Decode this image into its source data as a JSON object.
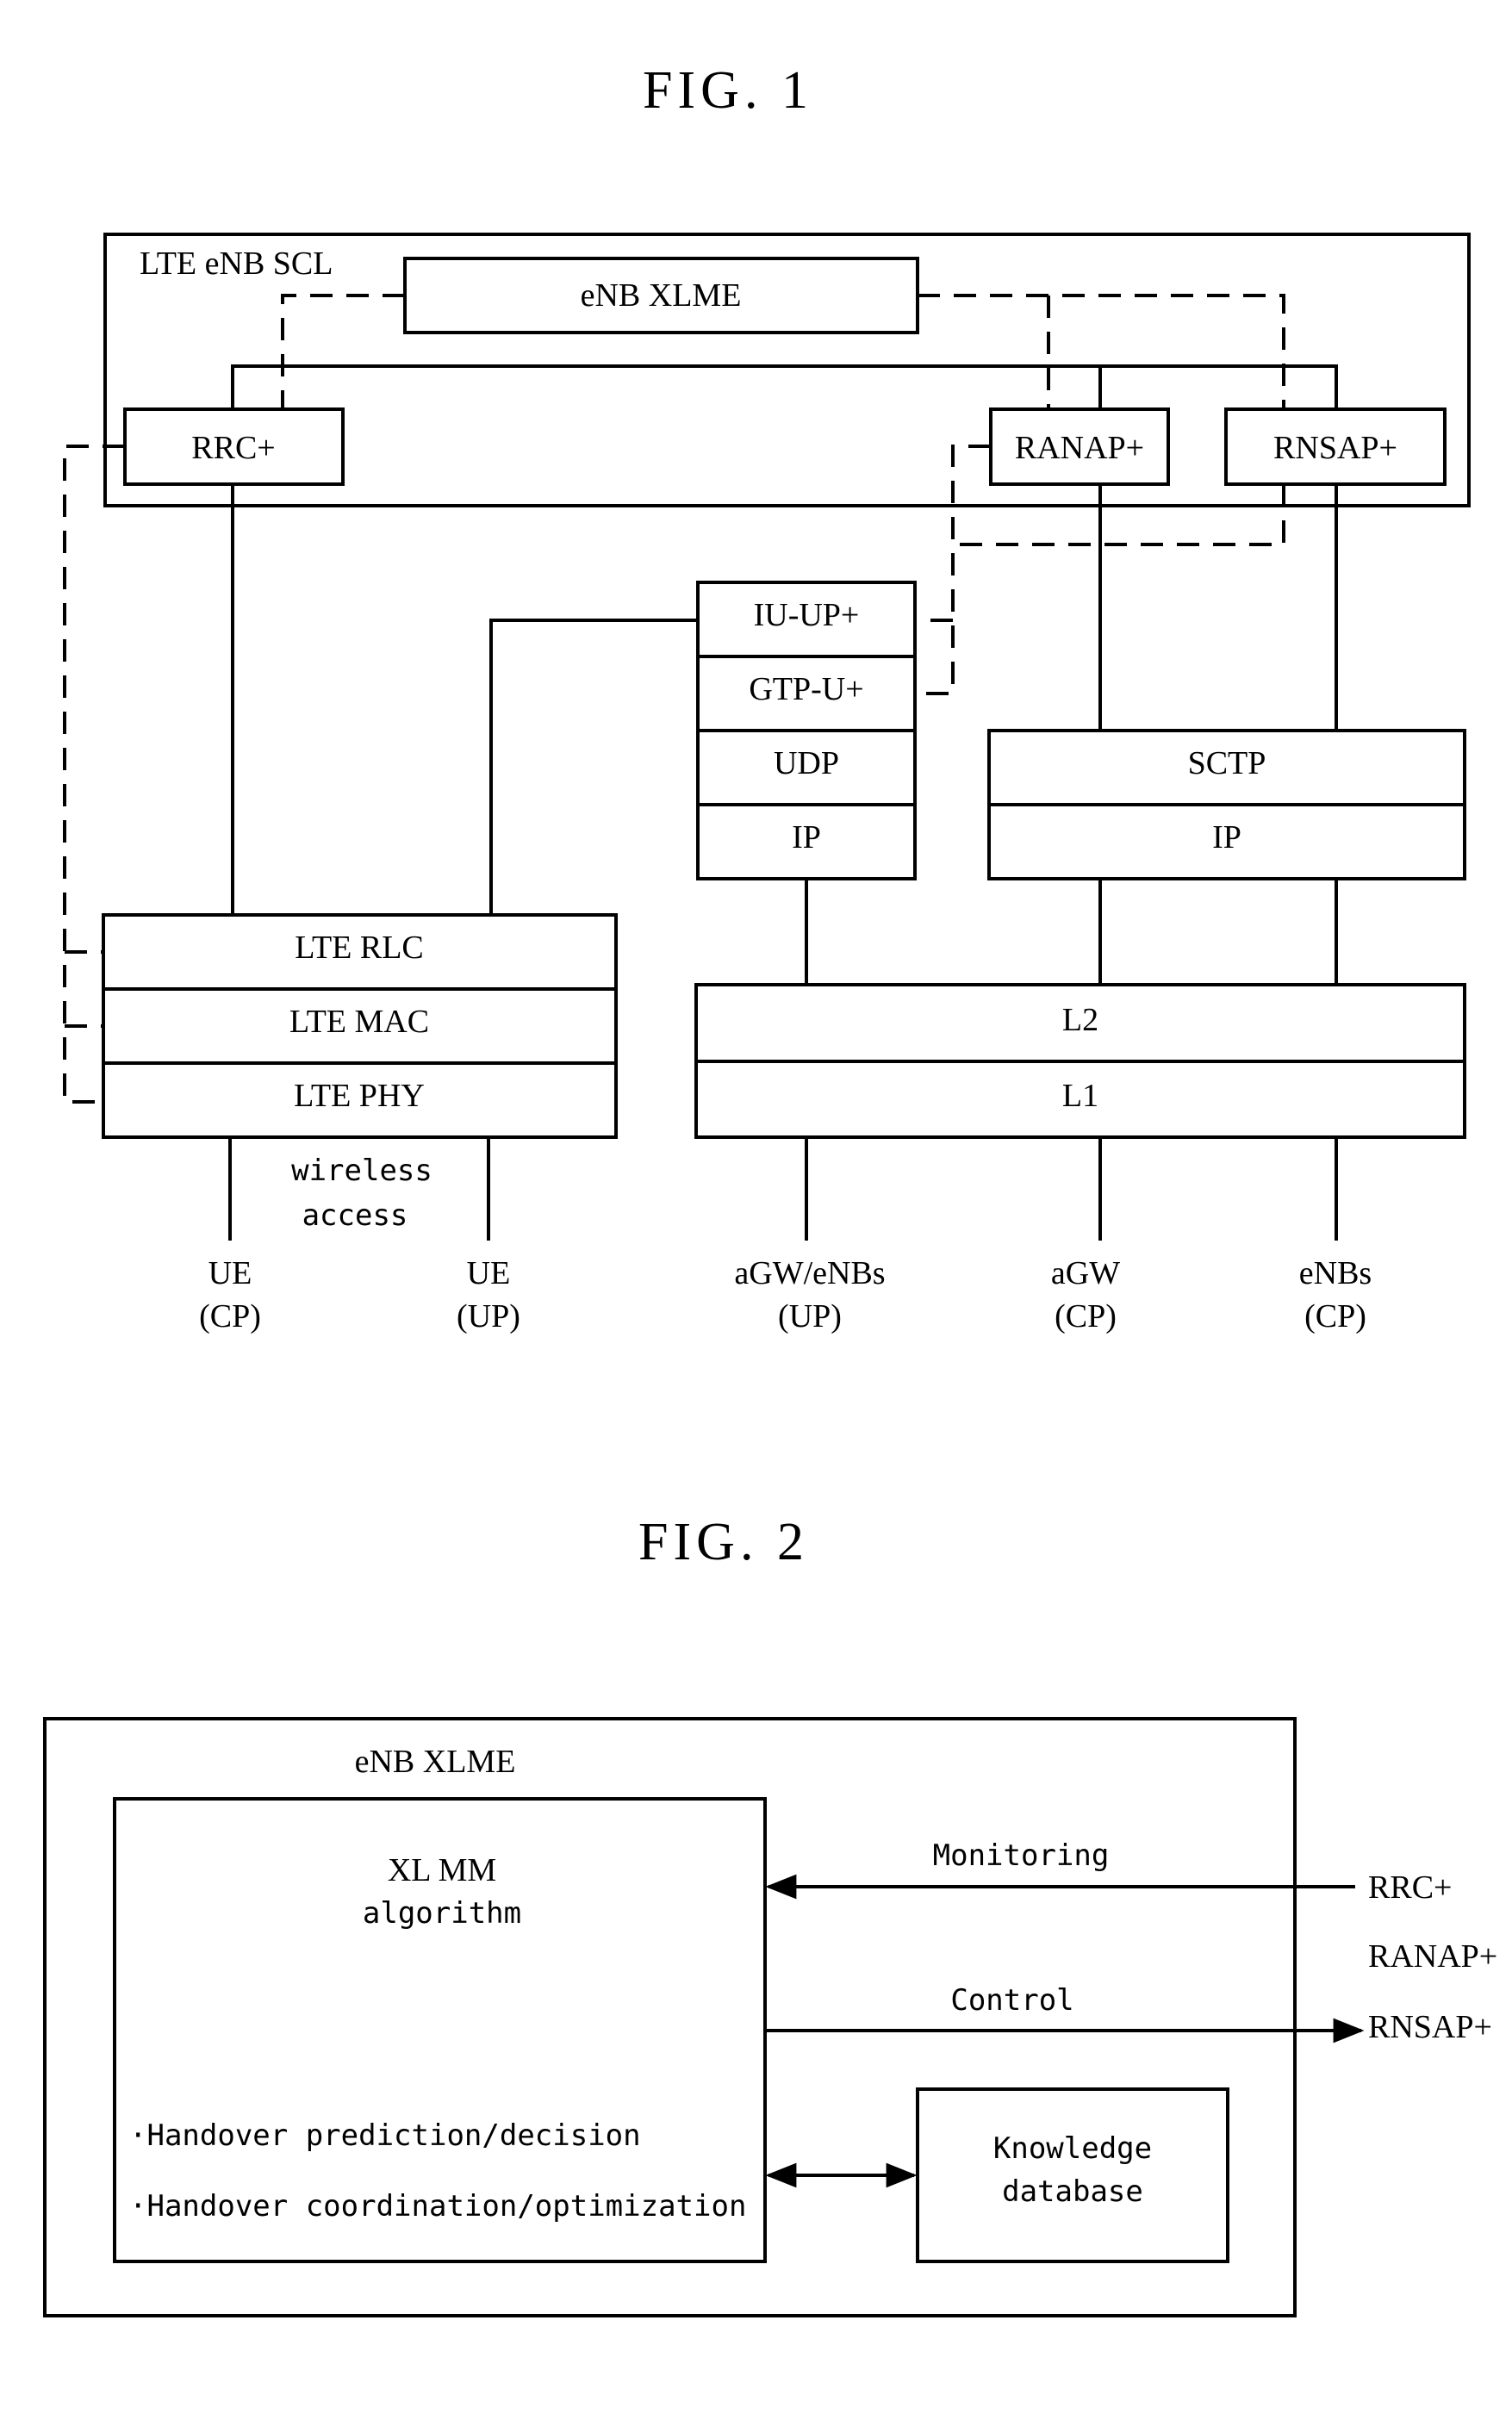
{
  "fig1": {
    "title": "FIG. 1",
    "container_label": "LTE eNB SCL",
    "xlme": "eNB XLME",
    "rrc": "RRC+",
    "ranap": "RANAP+",
    "rnsap": "RNSAP+",
    "up_stack": [
      "IU-UP+",
      "GTP-U+",
      "UDP",
      "IP"
    ],
    "cp_stack": [
      "SCTP",
      "IP"
    ],
    "lte_stack": [
      "LTE RLC",
      "LTE MAC",
      "LTE PHY"
    ],
    "transport": [
      "L2",
      "L1"
    ],
    "wireless_access": [
      "wireless",
      "access"
    ],
    "endpoints": [
      {
        "name": "UE",
        "plane": "(CP)"
      },
      {
        "name": "UE",
        "plane": "(UP)"
      },
      {
        "name": "aGW/eNBs",
        "plane": "(UP)"
      },
      {
        "name": "aGW",
        "plane": "(CP)"
      },
      {
        "name": "eNBs",
        "plane": "(CP)"
      }
    ]
  },
  "fig2": {
    "title": "FIG. 2",
    "container_label": "eNB XLME",
    "algo_title": [
      "XL MM",
      "algorithm"
    ],
    "bullets": [
      "·Handover prediction/decision",
      "·Handover coordination/optimization"
    ],
    "knowledge_db": [
      "Knowledge",
      "database"
    ],
    "monitoring": "Monitoring",
    "control": "Control",
    "protocols": [
      "RRC+",
      "RANAP+",
      "RNSAP+"
    ]
  }
}
